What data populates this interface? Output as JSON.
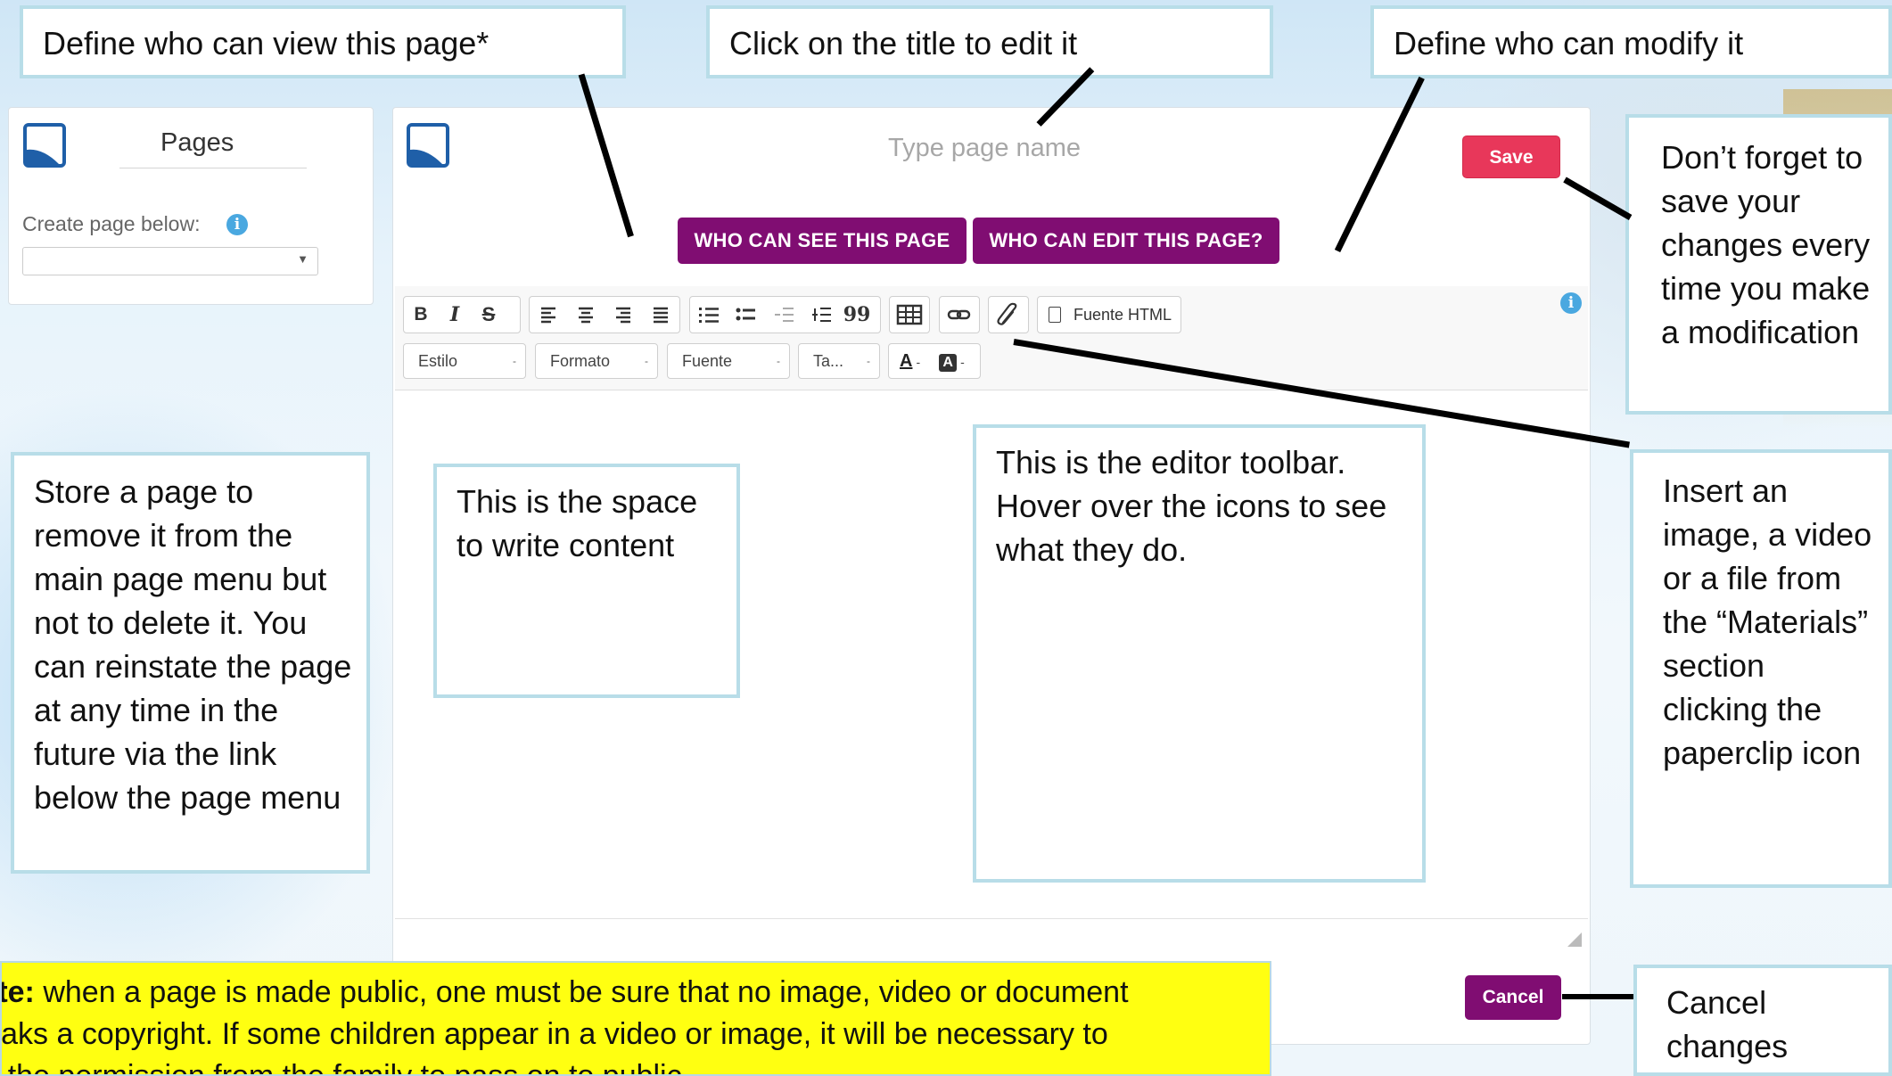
{
  "callouts": {
    "view": "Define who can view this page*",
    "title": "Click on the title to edit it",
    "modify": "Define who can modify it",
    "save": "Don’t forget to save your changes every time you make a modification",
    "store": "Store a page to remove it from the main page menu but not to delete it. You can reinstate the page at any time in the future via the link below the page menu",
    "content": "This is the space to write content",
    "toolbar": "This is the editor toolbar. Hover over the icons to see what they do.",
    "insert": "Insert an image, a video or a file from the “Materials” section clicking the paperclip icon",
    "cancel": "Cancel changes"
  },
  "sidebar": {
    "title": "Pages",
    "create_label": "Create page below:",
    "select_value": ""
  },
  "editor": {
    "page_name_placeholder": "Type page name",
    "save_label": "Save",
    "who_see_label": "WHO CAN SEE THIS PAGE",
    "who_edit_label": "WHO CAN EDIT THIS PAGE?",
    "cancel_label": "Cancel",
    "toolbar": {
      "bold": "B",
      "italic": "I",
      "strike": "S",
      "blockquote": "99",
      "source_label": "Fuente HTML",
      "style_label": "Estilo",
      "format_label": "Formato",
      "font_label": "Fuente",
      "size_label": "Ta...",
      "text_color": "A",
      "bg_color": "A",
      "dropdown_glyph": "-"
    }
  },
  "note": {
    "bold_prefix": "Note:",
    "line1": " when a page is made public, one must be sure that no image, video or document",
    "line2": "breaks a copyright. If some children appear in a video or image, it will be necessary to",
    "line3": "get the permission from the family to pass on to public."
  },
  "colors": {
    "save": "#e8375a",
    "purple": "#800d72",
    "callout_border": "#b8dde8",
    "note_bg": "#ffff11",
    "logo": "#1f5fa8"
  },
  "icons": [
    "logo-icon",
    "info-icon",
    "align-left-icon",
    "align-center-icon",
    "align-right-icon",
    "align-justify-icon",
    "numbered-list-icon",
    "bullet-list-icon",
    "outdent-icon",
    "indent-icon",
    "quote-icon",
    "table-icon",
    "link-icon",
    "paperclip-icon",
    "source-doc-icon",
    "resize-grip-icon"
  ]
}
